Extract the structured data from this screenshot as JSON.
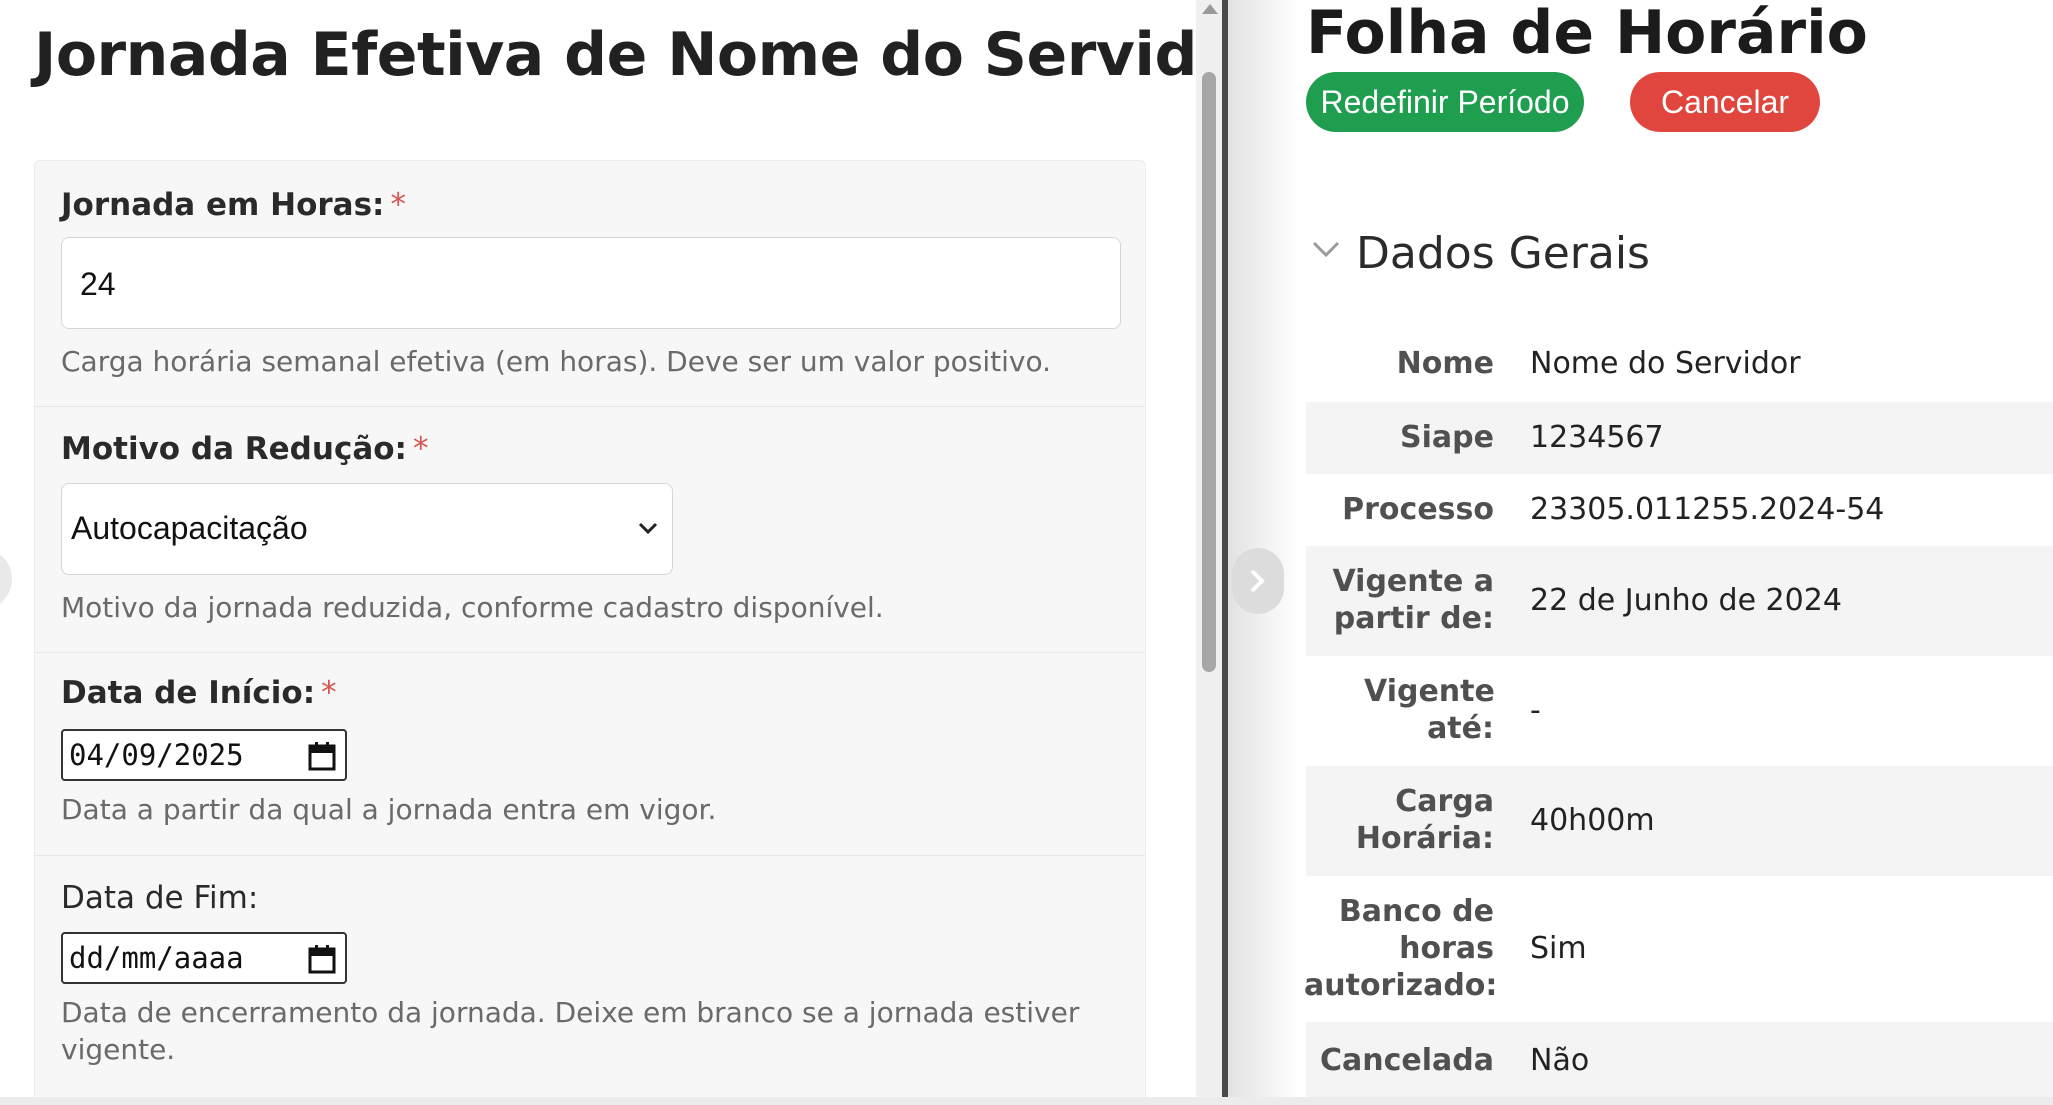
{
  "form": {
    "title": "Jornada Efetiva de Nome do Servidor",
    "jornada": {
      "label": "Jornada em Horas:",
      "required_mark": "*",
      "value": "24",
      "help": "Carga horária semanal efetiva (em horas). Deve ser um valor positivo."
    },
    "motivo": {
      "label": "Motivo da Redução:",
      "required_mark": "*",
      "selected": "Autocapacitação",
      "help": "Motivo da jornada reduzida, conforme cadastro disponível."
    },
    "data_inicio": {
      "label": "Data de Início:",
      "required_mark": "*",
      "value": "04/09/2025",
      "help": "Data a partir da qual a jornada entra em vigor."
    },
    "data_fim": {
      "label": "Data de Fim:",
      "placeholder": "dd/mm/aaaa",
      "help": "Data de encerramento da jornada. Deixe em branco se a jornada estiver vigente."
    }
  },
  "sheet": {
    "title": "Folha de Horário",
    "buttons": {
      "redefine": "Redefinir Período",
      "cancel": "Cancelar"
    },
    "colors": {
      "redefine": "#1f9e4f",
      "cancel": "#e0463d"
    },
    "section": {
      "title": "Dados Gerais",
      "toggle_icon": "chevron-down-icon",
      "rows": [
        {
          "label": "Nome",
          "value": "Nome do Servidor"
        },
        {
          "label": "Siape",
          "value": "1234567"
        },
        {
          "label": "Processo",
          "value": "23305.011255.2024-54"
        },
        {
          "label": "Vigente a partir de:",
          "value": "22 de Junho de 2024"
        },
        {
          "label": "Vigente até:",
          "value": "-"
        },
        {
          "label": "Carga Horária:",
          "value": "40h00m"
        },
        {
          "label": "Banco de horas autorizado:",
          "value": "Sim"
        },
        {
          "label": "Cancelada",
          "value": "Não"
        }
      ]
    }
  }
}
